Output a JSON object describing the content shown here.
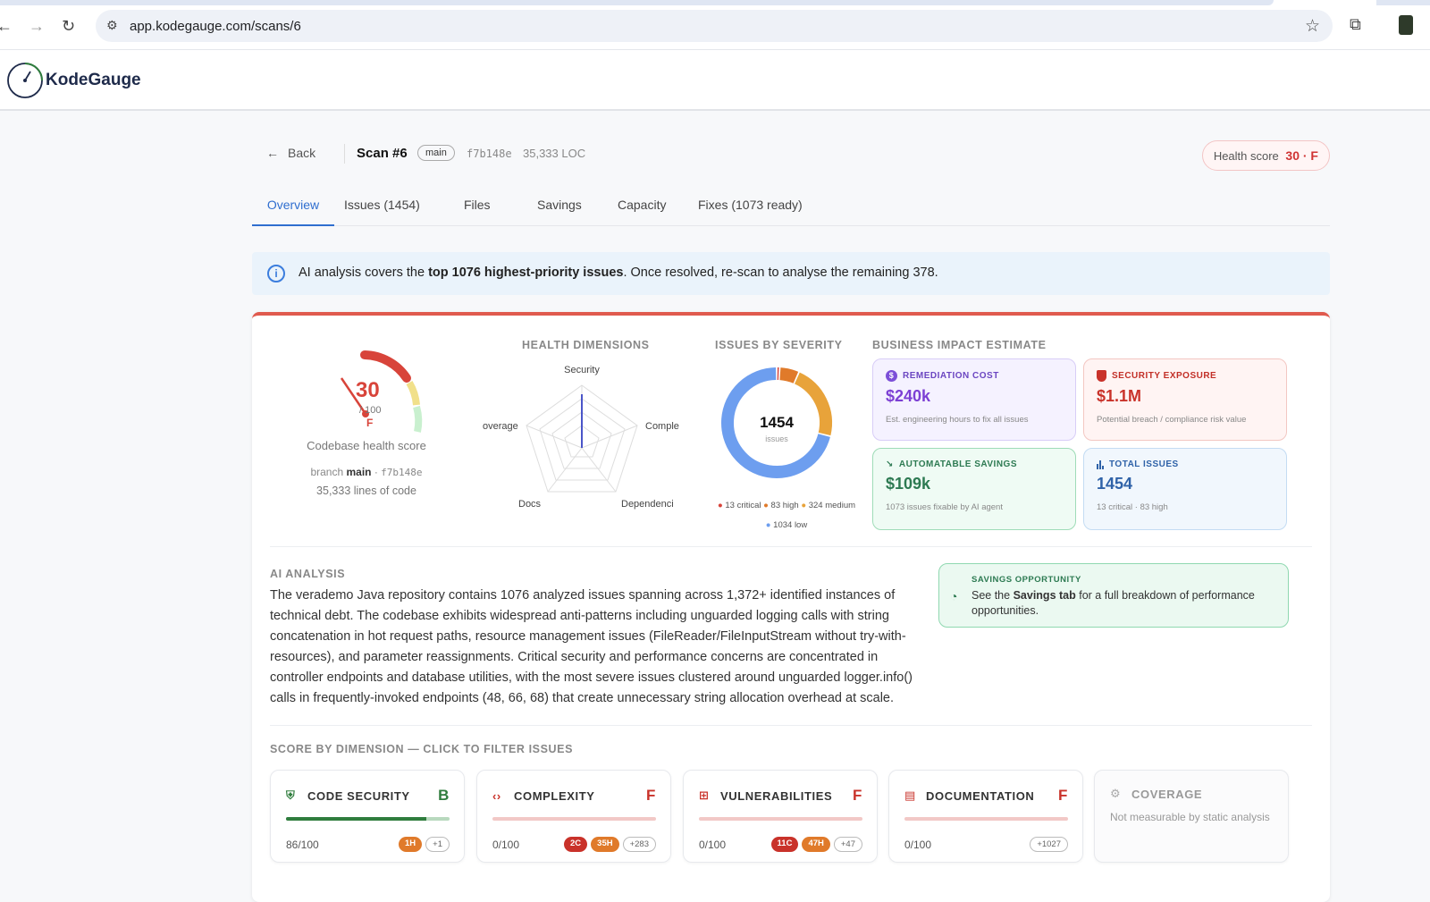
{
  "browser": {
    "url": "app.kodegauge.com/scans/6"
  },
  "app": {
    "name": "KodeGauge"
  },
  "header": {
    "back_label": "Back",
    "scan_title": "Scan #6",
    "branch": "main",
    "commit": "f7b148e",
    "loc": "35,333 LOC",
    "health_label": "Health score",
    "health_value": "30 · F"
  },
  "tabs": [
    "Overview",
    "Issues (1454)",
    "Files",
    "Savings",
    "Capacity",
    "Fixes (1073 ready)"
  ],
  "info_banner": {
    "pre": "AI analysis covers the ",
    "bold": "top 1076 highest-priority issues",
    "post": ". Once resolved, re-scan to analyse the remaining 378."
  },
  "gauge": {
    "score": 30,
    "score_text": "30",
    "denominator": "/ 100",
    "grade": "F",
    "label": "Codebase health score",
    "branch_prefix": "branch ",
    "branch": "main",
    "sep": " · ",
    "commit": "f7b148e",
    "lines": "35,333 lines of code"
  },
  "health_dimensions": {
    "title": "HEALTH DIMENSIONS",
    "axes": [
      "Security",
      "Comple",
      "Dependenci",
      "Docs",
      "overage"
    ]
  },
  "severity": {
    "title": "ISSUES BY SEVERITY",
    "total": "1454",
    "total_label": "issues",
    "legend": [
      "13 critical",
      "83 high",
      "324 medium",
      "1034 low"
    ]
  },
  "chart_data": {
    "type": "pie",
    "title": "ISSUES BY SEVERITY",
    "categories": [
      "critical",
      "high",
      "medium",
      "low"
    ],
    "values": [
      13,
      83,
      324,
      1034
    ],
    "colors": [
      "#d8443a",
      "#e07a2a",
      "#e8a33a",
      "#6d9eef"
    ]
  },
  "business": {
    "title": "BUSINESS IMPACT ESTIMATE",
    "cards": [
      {
        "title": "REMEDIATION COST",
        "value": "$240k",
        "sub": "Est. engineering hours to fix all issues"
      },
      {
        "title": "SECURITY EXPOSURE",
        "value": "$1.1M",
        "sub": "Potential breach / compliance risk value"
      },
      {
        "title": "AUTOMATABLE SAVINGS",
        "value": "$109k",
        "sub": "1073 issues fixable by AI agent"
      },
      {
        "title": "TOTAL ISSUES",
        "value": "1454",
        "sub": "13 critical · 83 high"
      }
    ]
  },
  "ai_analysis": {
    "title": "AI ANALYSIS",
    "body": "The verademo Java repository contains 1076 analyzed issues spanning across 1,372+ identified instances of technical debt. The codebase exhibits widespread anti-patterns including unguarded logging calls with string concatenation in hot request paths, resource management issues (FileReader/FileInputStream without try-with-resources), and parameter reassignments. Critical security and performance concerns are concentrated in controller endpoints and database utilities, with the most severe issues clustered around unguarded logger.info() calls in frequently-invoked endpoints (48, 66, 68) that create unnecessary string allocation overhead at scale."
  },
  "savings_opportunity": {
    "title": "SAVINGS OPPORTUNITY",
    "pre": "See the ",
    "bold": "Savings tab",
    "post": " for a full breakdown of performance opportunities."
  },
  "dimensions": {
    "title": "SCORE BY DIMENSION — CLICK TO FILTER ISSUES",
    "items": [
      {
        "name": "CODE SECURITY",
        "grade": "B",
        "score": "86/100",
        "fill": 0.86,
        "chips": [
          "1H",
          "+1"
        ]
      },
      {
        "name": "COMPLEXITY",
        "grade": "F",
        "score": "0/100",
        "fill": 0,
        "chips": [
          "2C",
          "35H",
          "+283"
        ]
      },
      {
        "name": "VULNERABILITIES",
        "grade": "F",
        "score": "0/100",
        "fill": 0,
        "chips": [
          "11C",
          "47H",
          "+47"
        ]
      },
      {
        "name": "DOCUMENTATION",
        "grade": "F",
        "score": "0/100",
        "fill": 0,
        "chips": [
          "+1027"
        ]
      },
      {
        "name": "COVERAGE",
        "note": "Not measurable by static analysis"
      }
    ]
  },
  "colors": {
    "accent": "#2f6ecf",
    "danger": "#d8443a",
    "success": "#2f7d3d"
  }
}
